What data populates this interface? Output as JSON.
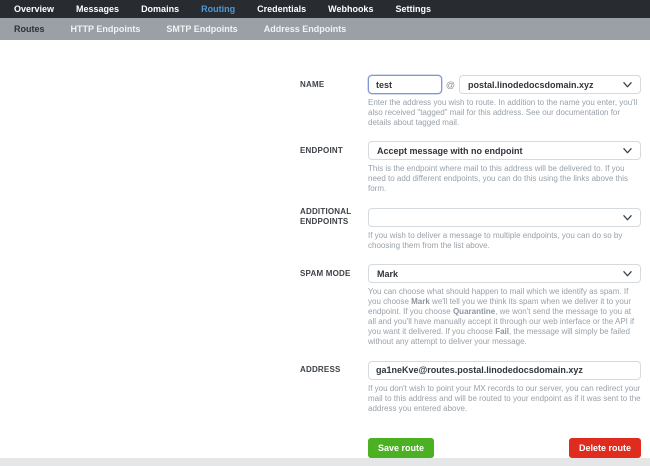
{
  "topnav": {
    "items": [
      {
        "label": "Overview",
        "active": false
      },
      {
        "label": "Messages",
        "active": false
      },
      {
        "label": "Domains",
        "active": false
      },
      {
        "label": "Routing",
        "active": true
      },
      {
        "label": "Credentials",
        "active": false
      },
      {
        "label": "Webhooks",
        "active": false
      },
      {
        "label": "Settings",
        "active": false
      }
    ]
  },
  "subnav": {
    "items": [
      {
        "label": "Routes",
        "active": true
      },
      {
        "label": "HTTP Endpoints",
        "active": false
      },
      {
        "label": "SMTP Endpoints",
        "active": false
      },
      {
        "label": "Address Endpoints",
        "active": false
      }
    ]
  },
  "form": {
    "name": {
      "label": "NAME",
      "value": "test",
      "at_sign": "@",
      "domain_selected": "postal.linodedocsdomain.xyz",
      "help": "Enter the address you wish to route. In addition to the name you enter, you'll also received \"tagged\" mail for this address. See our documentation for details about tagged mail."
    },
    "endpoint": {
      "label": "ENDPOINT",
      "selected": "Accept message with no endpoint",
      "help": "This is the endpoint where mail to this address will be delivered to. If you need to add different endpoints, you can do this using the links above this form."
    },
    "additional_endpoints": {
      "label_line1": "ADDITIONAL",
      "label_line2": "ENDPOINTS",
      "selected": "",
      "help": "If you wish to deliver a message to multiple endpoints, you can do so by choosing them from the list above."
    },
    "spam_mode": {
      "label": "SPAM MODE",
      "selected": "Mark",
      "help_segments": [
        {
          "text": "You can choose what should happen to mail which we identify as spam. If you choose ",
          "bold": false
        },
        {
          "text": "Mark",
          "bold": true
        },
        {
          "text": " we'll tell you we think its spam when we deliver it to your endpoint. If you choose ",
          "bold": false
        },
        {
          "text": "Quarantine",
          "bold": true
        },
        {
          "text": ", we won't send the message to you at all and you'll have manually accept it through our web interface or the API if you want it delivered. If you choose ",
          "bold": false
        },
        {
          "text": "Fail",
          "bold": true
        },
        {
          "text": ", the message will simply be failed without any attempt to deliver your message.",
          "bold": false
        }
      ]
    },
    "address": {
      "label": "ADDRESS",
      "value": "ga1neKve@routes.postal.linodedocsdomain.xyz",
      "help": "If you don't wish to point your MX records to our server, you can redirect your mail to this address and will be routed to your endpoint as if it was sent to the address you entered above."
    },
    "buttons": {
      "save": "Save route",
      "delete": "Delete route"
    }
  },
  "colors": {
    "topnav_bg": "#282b30",
    "topnav_active": "#4a99d9",
    "subnav_bg": "#9aa0a5",
    "save_green": "#4cb122",
    "delete_red": "#e02b1f",
    "focused_input_border": "#8295d6",
    "help_text": "#99a1aa"
  }
}
